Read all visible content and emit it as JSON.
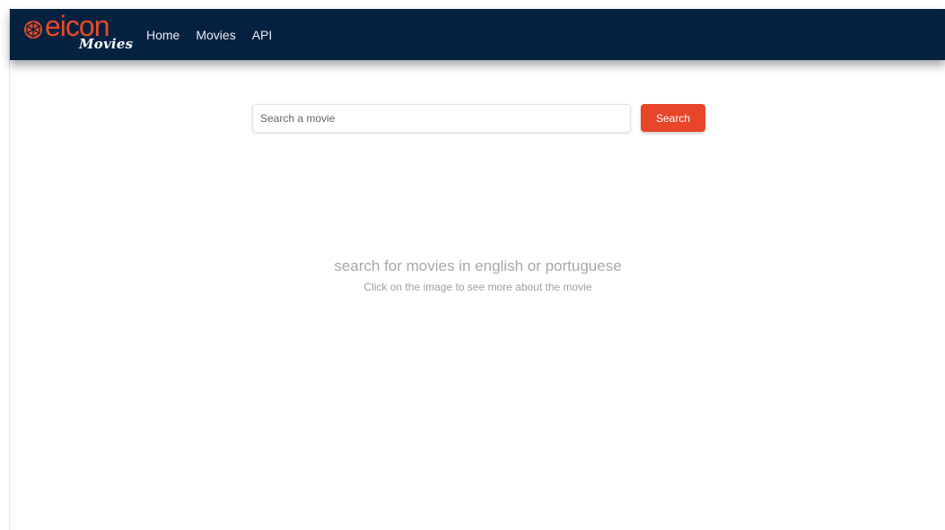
{
  "brand": {
    "word": "eicon",
    "sub": "Movies",
    "icon": "globe-icon",
    "accent_color": "#e84a2a"
  },
  "nav": {
    "background_color": "#042140",
    "items": [
      {
        "label": "Home"
      },
      {
        "label": "Movies"
      },
      {
        "label": "API"
      }
    ]
  },
  "search": {
    "placeholder": "Search a movie",
    "value": "",
    "button_label": "Search",
    "button_color": "#e8452a"
  },
  "empty_state": {
    "title": "search for movies in english or portuguese",
    "subtitle": "Click on the image to see more about the movie"
  }
}
